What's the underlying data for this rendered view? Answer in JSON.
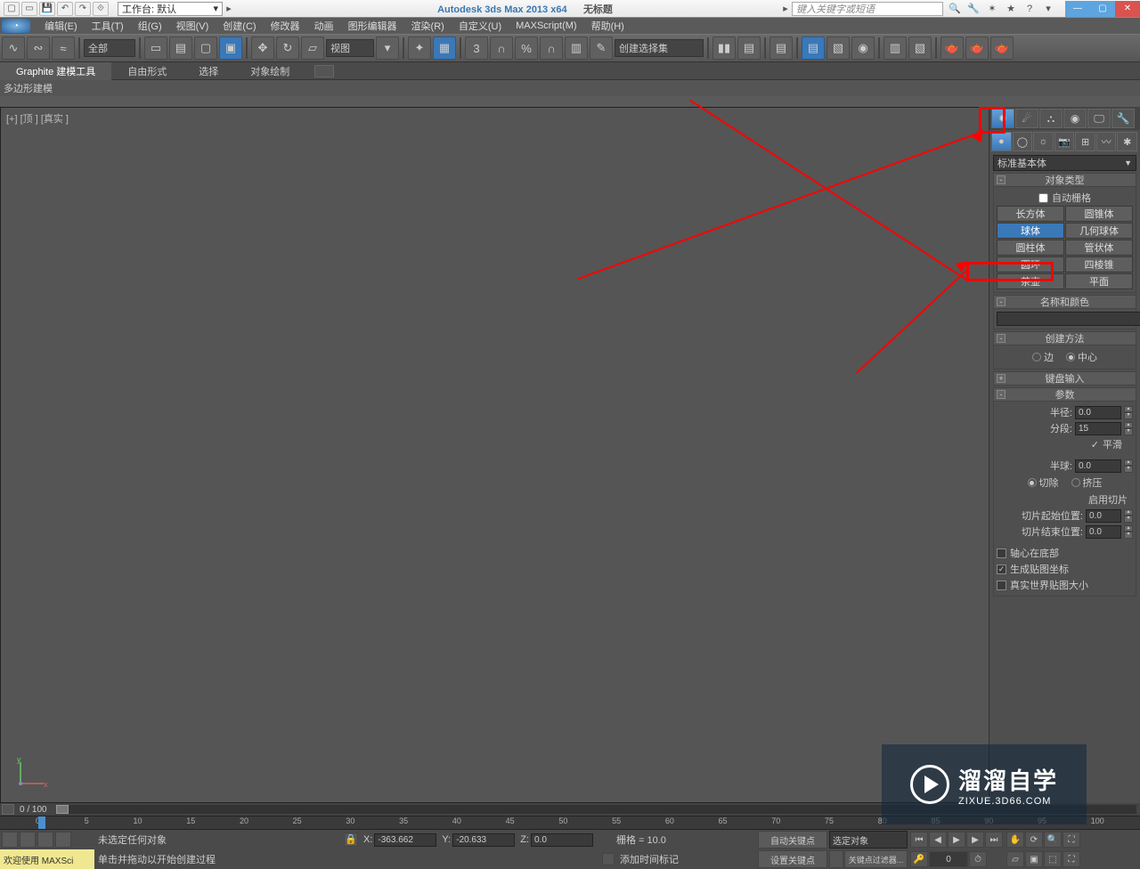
{
  "titlebar": {
    "workspace_label": "工作台: 默认",
    "app_title": "Autodesk 3ds Max  2013 x64",
    "doc_title": "无标题",
    "search_placeholder": "键入关键字或短语"
  },
  "menu": [
    "编辑(E)",
    "工具(T)",
    "组(G)",
    "视图(V)",
    "创建(C)",
    "修改器",
    "动画",
    "图形编辑器",
    "渲染(R)",
    "自定义(U)",
    "MAXScript(M)",
    "帮助(H)"
  ],
  "maintoolbar": {
    "filter_dd": "全部",
    "refcoord_dd": "视图",
    "named_sel_dd": "创建选择集"
  },
  "ribbon": {
    "tabs": [
      "Graphite 建模工具",
      "自由形式",
      "选择",
      "对象绘制"
    ],
    "sub": "多边形建模"
  },
  "viewport": {
    "label": "[+] [顶 ] [真实 ]"
  },
  "cmd": {
    "geom_dd": "标准基本体",
    "obj_type_header": "对象类型",
    "autogrid": "自动栅格",
    "objects": [
      "长方体",
      "圆锥体",
      "球体",
      "几何球体",
      "圆柱体",
      "管状体",
      "圆环",
      "四棱锥",
      "茶壶",
      "平面"
    ],
    "name_color_header": "名称和颜色",
    "create_method_header": "创建方法",
    "cm_edge": "边",
    "cm_center": "中心",
    "kb_header": "键盘输入",
    "params_header": "参数",
    "radius_lbl": "半径:",
    "radius_val": "0.0",
    "segments_lbl": "分段:",
    "segments_val": "15",
    "smooth": "平滑",
    "hemi_lbl": "半球:",
    "hemi_val": "0.0",
    "chop": "切除",
    "squash": "挤压",
    "slice_on": "启用切片",
    "slice_from_lbl": "切片起始位置:",
    "slice_from_val": "0.0",
    "slice_to_lbl": "切片结束位置:",
    "slice_to_val": "0.0",
    "base_pivot": "轴心在底部",
    "gen_uv": "生成贴图坐标",
    "real_world": "真实世界贴图大小"
  },
  "bottom": {
    "frame_label": "0 / 100",
    "timeline_nums": [
      "0",
      "5",
      "10",
      "15",
      "20",
      "25",
      "30",
      "35",
      "40",
      "45",
      "50",
      "55",
      "60",
      "65",
      "70",
      "75",
      "80",
      "85",
      "90",
      "95",
      "100"
    ],
    "no_sel": "未选定任何对象",
    "x": "X:",
    "xv": "-363.662",
    "y": "Y:",
    "yv": "-20.633",
    "z": "Z:",
    "zv": "0.0",
    "grid": "栅格 = 10.0",
    "welcome": "欢迎使用  MAXSci",
    "hint": "单击并拖动以开始创建过程",
    "addtime": "添加时间标记",
    "autokey": "自动关键点",
    "setkey": "设置关键点",
    "seldrop": "选定对象",
    "keyfilter": "关键点过滤器..."
  },
  "watermark": {
    "big": "溜溜自学",
    "small": "ZIXUE.3D66.COM"
  }
}
